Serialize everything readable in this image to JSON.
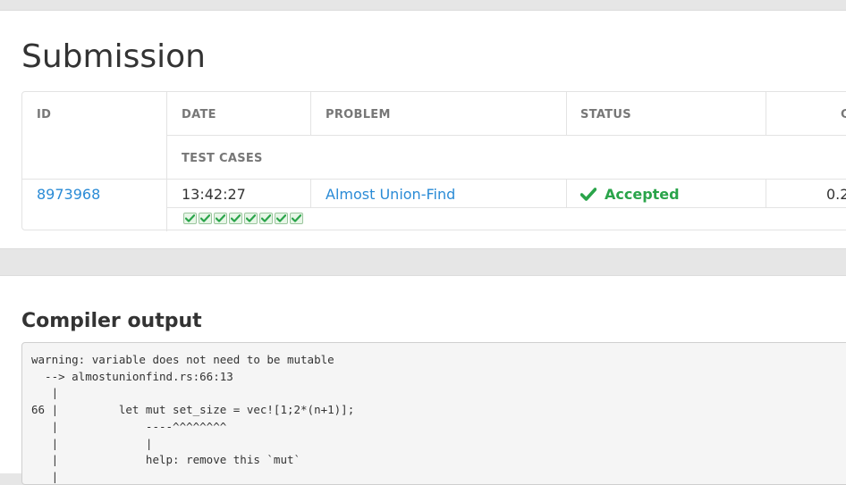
{
  "page": {
    "title": "Submission"
  },
  "table": {
    "headers": {
      "id": "ID",
      "date": "DATE",
      "problem": "PROBLEM",
      "status": "STATUS",
      "cpu_partial": "C",
      "test_cases": "TEST CASES"
    },
    "row": {
      "id": "8973968",
      "date": "13:42:27",
      "problem": "Almost Union-Find",
      "status": "Accepted",
      "cpu_partial": "0.2",
      "test_case_count": 8,
      "test_case_result": "passed"
    }
  },
  "compiler": {
    "title": "Compiler output",
    "lines": [
      "warning: variable does not need to be mutable",
      "  --> almostunionfind.rs:66:13",
      "   |",
      "66 |         let mut set_size = vec![1;2*(n+1)];",
      "   |             ----^^^^^^^^",
      "   |             |",
      "   |             help: remove this `mut`",
      "   |"
    ]
  },
  "colors": {
    "link": "#2a8bd6",
    "accepted": "#2aa44a",
    "header_text": "#777777"
  }
}
